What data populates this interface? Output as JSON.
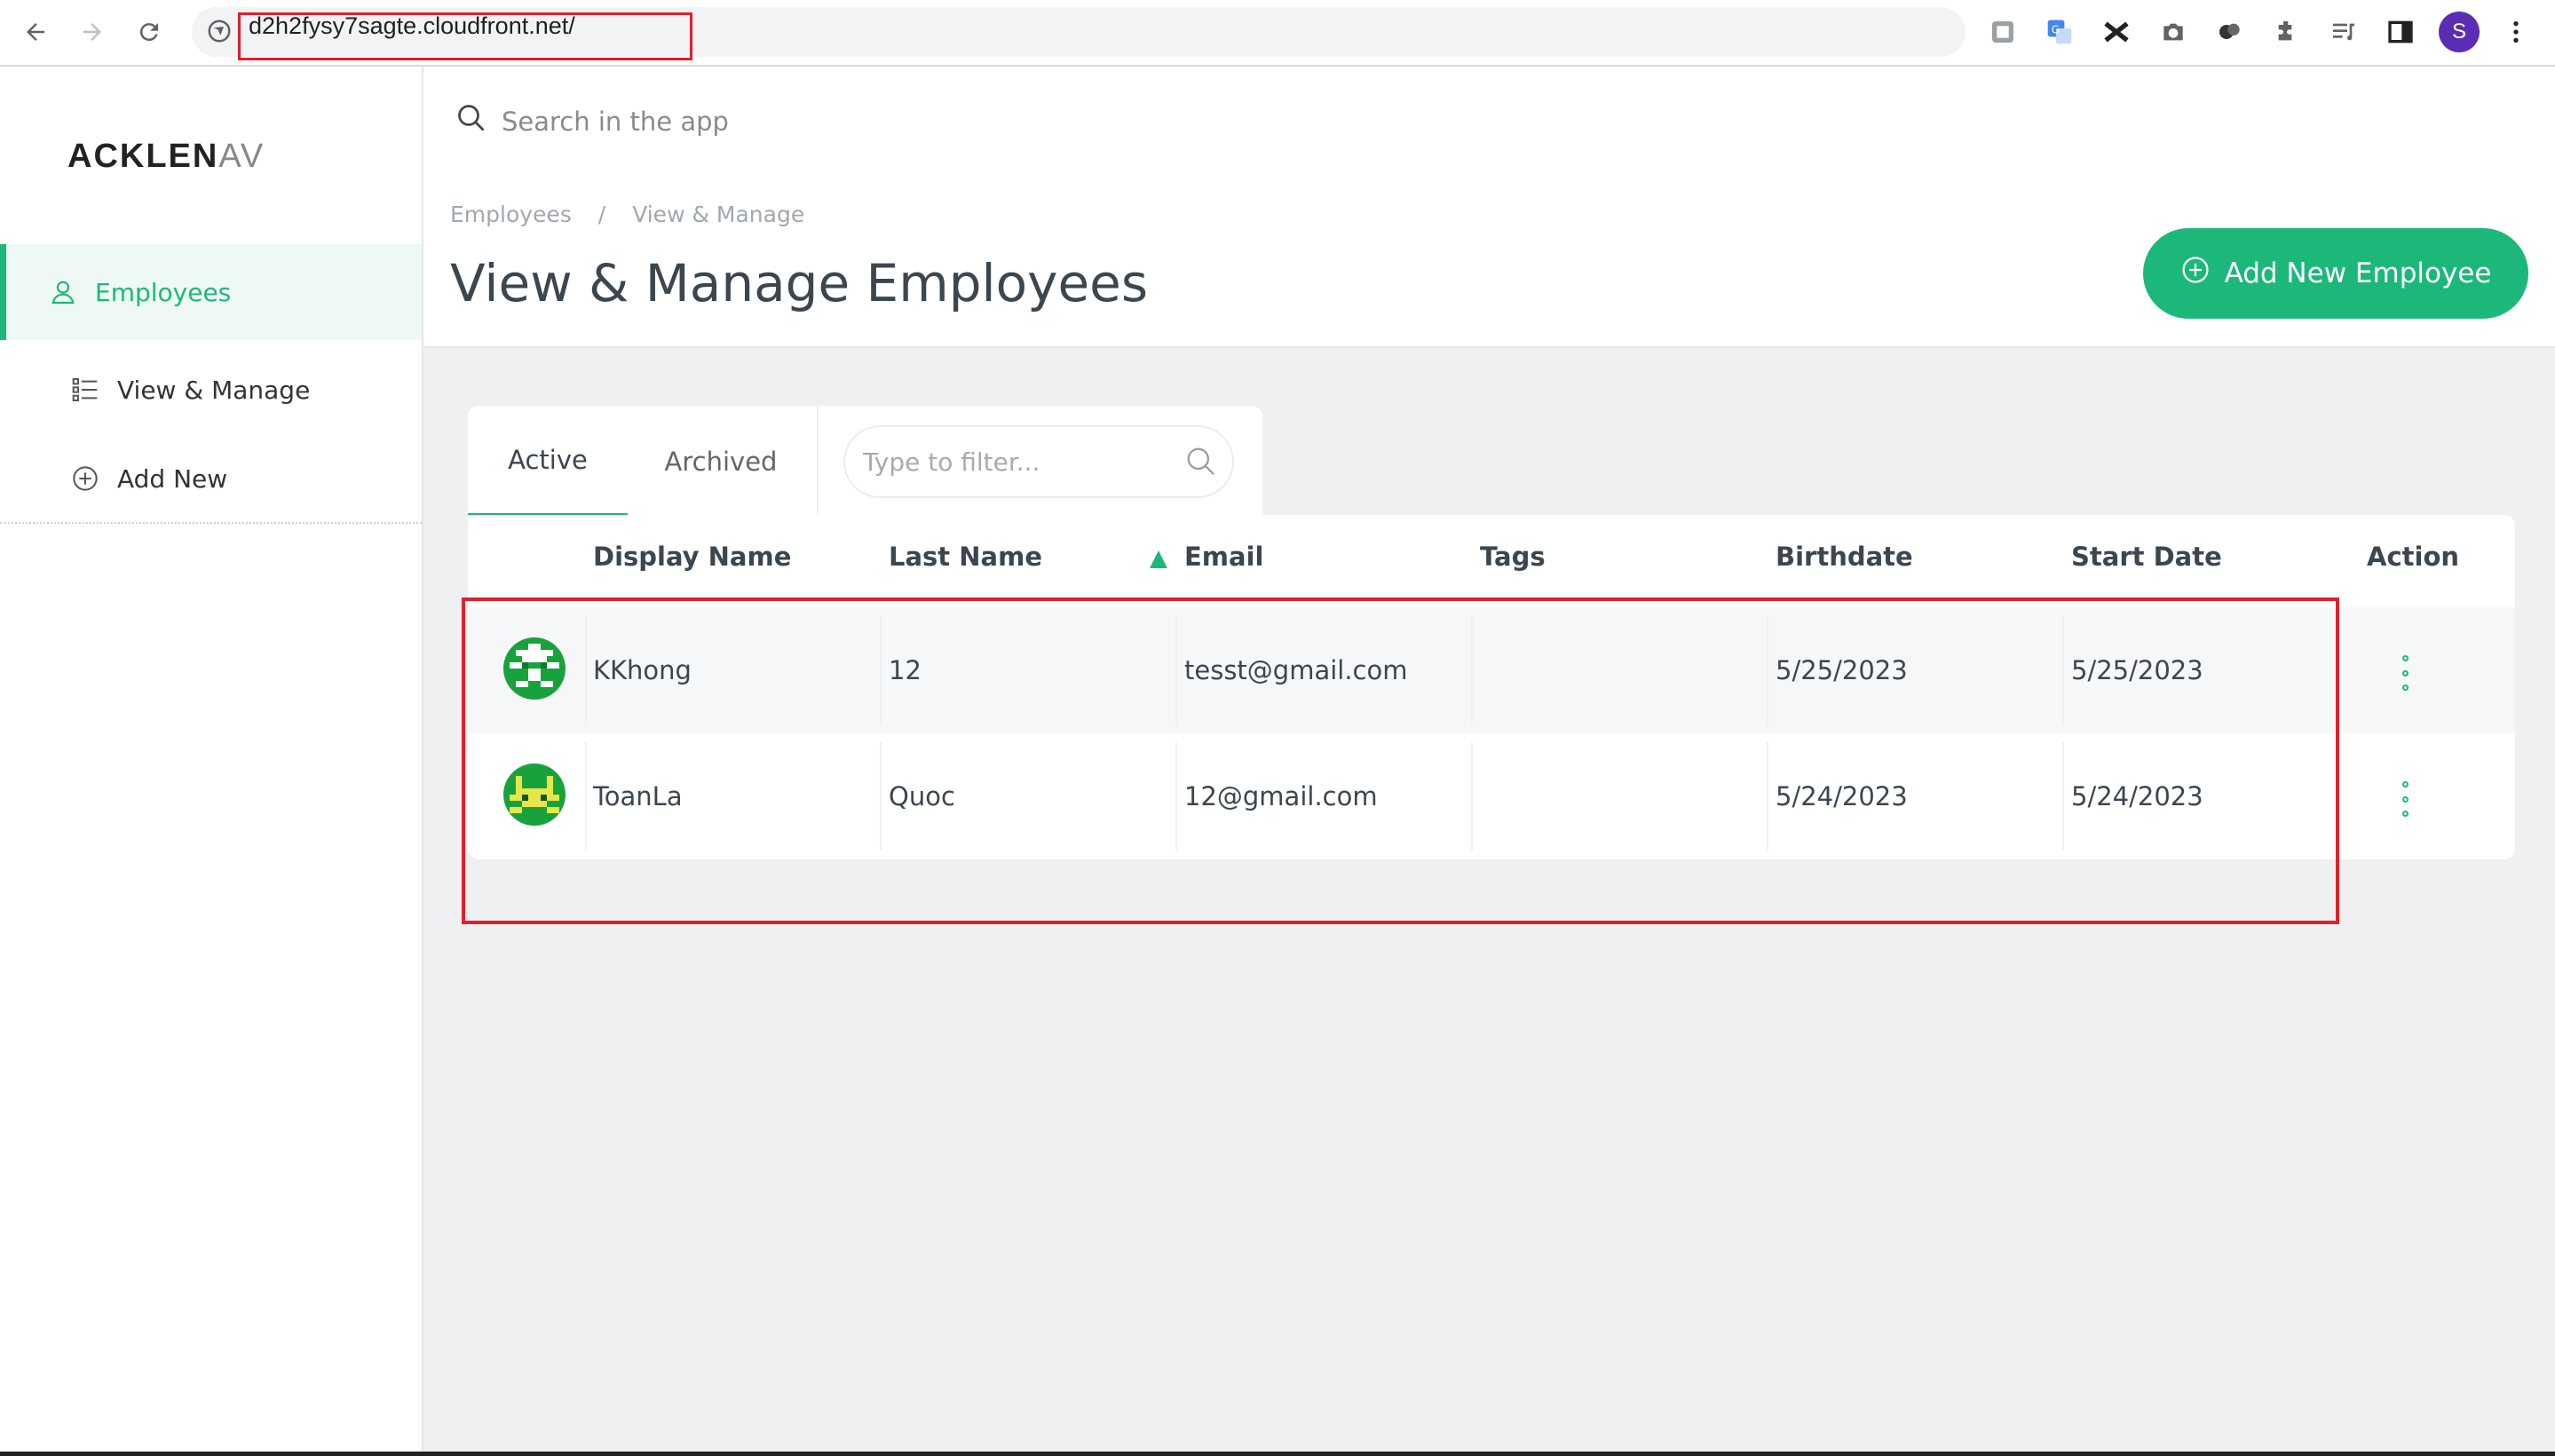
{
  "browser": {
    "url": "d2h2fysy7sagte.cloudfront.net/",
    "profile_initial": "S"
  },
  "sidebar": {
    "logo_main": "ACKLEN",
    "logo_fade": "AV",
    "items": [
      {
        "label": "Employees",
        "icon": "user-icon",
        "active": true
      },
      {
        "label": "View & Manage",
        "icon": "list-icon"
      },
      {
        "label": "Add New",
        "icon": "plus-circle-icon"
      }
    ]
  },
  "topbar": {
    "search_label": "Search in the app"
  },
  "header": {
    "breadcrumb": [
      "Employees",
      "/",
      "View & Manage"
    ],
    "title": "View & Manage Employees",
    "add_button": "Add New Employee"
  },
  "tabs": {
    "active": "Active",
    "archived": "Archived",
    "filter_placeholder": "Type to filter..."
  },
  "table": {
    "columns": [
      "Display Name",
      "Last Name",
      "Email",
      "Tags",
      "Birthdate",
      "Start Date",
      "Action"
    ],
    "rows": [
      {
        "display_name": "KKhong",
        "last_name": "12",
        "email": "tesst@gmail.com",
        "tags": "",
        "birthdate": "5/25/2023",
        "start_date": "5/25/2023"
      },
      {
        "display_name": "ToanLa",
        "last_name": "Quoc",
        "email": "12@gmail.com",
        "tags": "",
        "birthdate": "5/24/2023",
        "start_date": "5/24/2023"
      }
    ]
  },
  "colors": {
    "accent": "#1cb87a",
    "highlight": "#e0202a"
  }
}
